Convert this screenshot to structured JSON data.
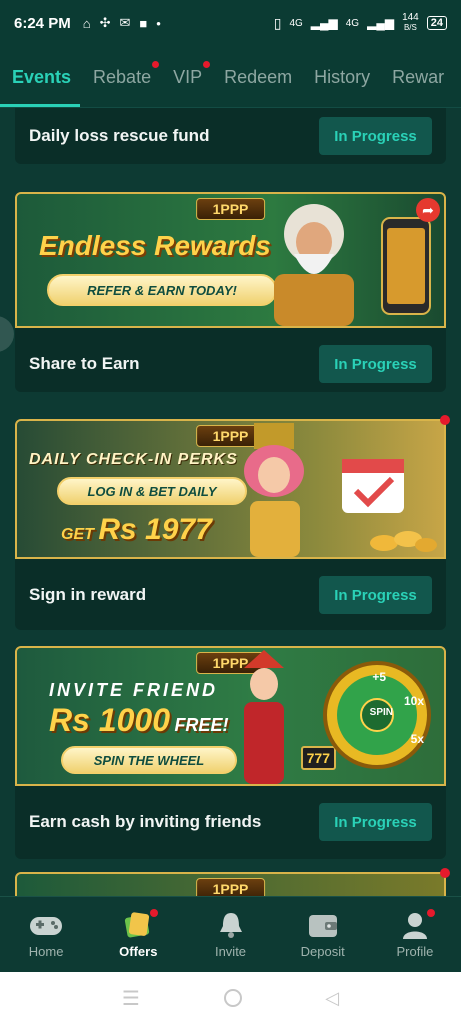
{
  "status": {
    "time": "6:24 PM",
    "network_1": "4G",
    "network_2": "4G",
    "speed": "144",
    "speed_unit": "B/S",
    "battery": "24"
  },
  "tabs": [
    {
      "label": "Events",
      "active": true,
      "dot": false
    },
    {
      "label": "Rebate",
      "active": false,
      "dot": true
    },
    {
      "label": "VIP",
      "active": false,
      "dot": true
    },
    {
      "label": "Redeem",
      "active": false,
      "dot": false
    },
    {
      "label": "History",
      "active": false,
      "dot": false
    },
    {
      "label": "Rewar",
      "active": false,
      "dot": false
    }
  ],
  "events": [
    {
      "title": "Daily loss rescue fund",
      "button": "In Progress"
    },
    {
      "title": "Share to Earn",
      "button": "In Progress",
      "banner": {
        "logo": "1PPP",
        "headline": "Endless Rewards",
        "pill": "REFER & EARN TODAY!"
      }
    },
    {
      "title": "Sign in reward",
      "button": "In Progress",
      "banner": {
        "logo": "1PPP",
        "headline": "DAILY CHECK-IN PERKS",
        "pill": "LOG IN & BET DAILY",
        "get": "GET",
        "amount": "Rs 1977"
      }
    },
    {
      "title": "Earn cash by inviting friends",
      "button": "In Progress",
      "banner": {
        "logo": "1PPP",
        "headline": "INVITE FRIEND",
        "amount": "Rs 1000",
        "free": "FREE!",
        "pill": "SPIN THE WHEEL",
        "wheel_center": "SPIN",
        "wheel_1": "+5",
        "wheel_2": "10x",
        "wheel_3": "5x",
        "slot": "777"
      }
    },
    {
      "banner": {
        "logo": "1PPP"
      }
    }
  ],
  "nav": [
    {
      "label": "Home",
      "icon": "gamepad-icon",
      "active": false,
      "dot": false
    },
    {
      "label": "Offers",
      "icon": "offers-icon",
      "active": true,
      "dot": true
    },
    {
      "label": "Invite",
      "icon": "bell-icon",
      "active": false,
      "dot": false
    },
    {
      "label": "Deposit",
      "icon": "wallet-icon",
      "active": false,
      "dot": false
    },
    {
      "label": "Profile",
      "icon": "profile-icon",
      "active": false,
      "dot": true
    }
  ],
  "colors": {
    "accent": "#2ad1b7",
    "background": "#0d3a33",
    "card": "#0a2e28",
    "button": "#12574d",
    "badge": "#e51a2c",
    "gold": "#d9b44a"
  }
}
